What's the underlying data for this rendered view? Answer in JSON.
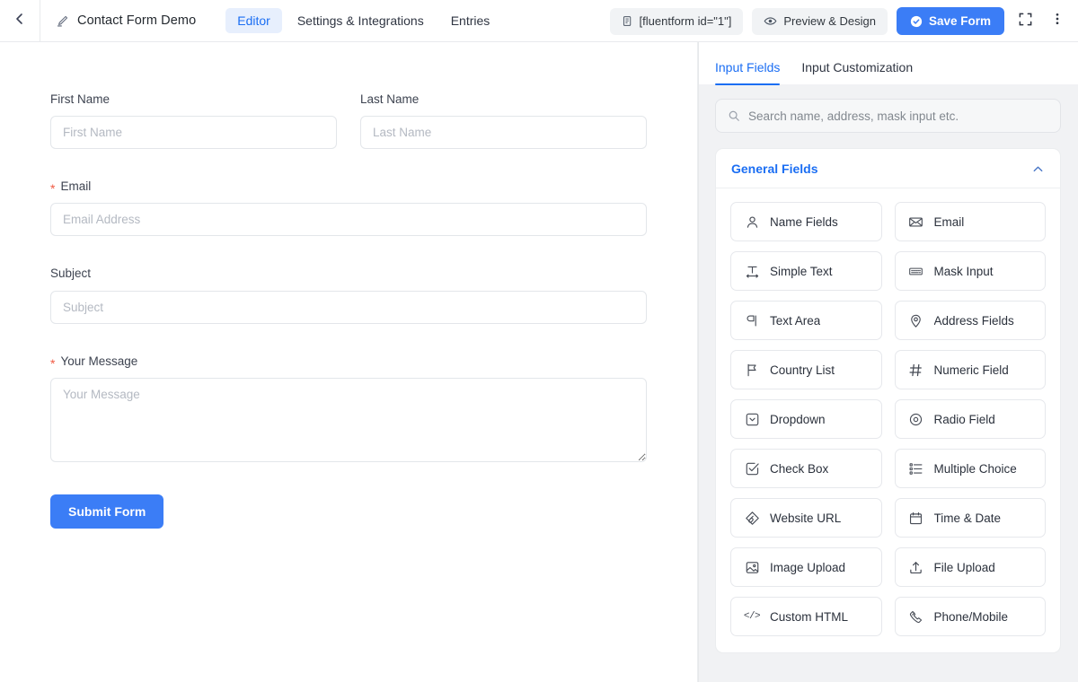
{
  "topbar": {
    "back_icon": "chevron-left-icon",
    "edit_icon": "pencil-icon",
    "form_title": "Contact Form Demo",
    "tabs": [
      {
        "label": "Editor",
        "active": true
      },
      {
        "label": "Settings & Integrations",
        "active": false
      },
      {
        "label": "Entries",
        "active": false
      }
    ],
    "shortcode_chip": {
      "icon": "copy-icon",
      "label": "[fluentform id=\"1\"]"
    },
    "preview_chip": {
      "icon": "eye-icon",
      "label": "Preview & Design"
    },
    "save_button": {
      "icon": "check-circle-icon",
      "label": "Save Form",
      "color": "#3b7df6"
    },
    "fullscreen_icon": "expand-icon",
    "more_icon": "kebab-menu-icon"
  },
  "canvas": {
    "fields": [
      {
        "label": "First Name",
        "required": false,
        "placeholder": "First Name",
        "type": "text",
        "half": true
      },
      {
        "label": "Last Name",
        "required": false,
        "placeholder": "Last Name",
        "type": "text",
        "half": true
      },
      {
        "label": "Email",
        "required": true,
        "placeholder": "Email Address",
        "type": "text",
        "half": false
      },
      {
        "label": "Subject",
        "required": false,
        "placeholder": "Subject",
        "type": "text",
        "half": false
      },
      {
        "label": "Your Message",
        "required": true,
        "placeholder": "Your Message",
        "type": "textarea",
        "half": false
      }
    ],
    "required_marker": "*",
    "submit_label": "Submit Form"
  },
  "sidebar": {
    "tabs": [
      {
        "label": "Input Fields",
        "active": true
      },
      {
        "label": "Input Customization",
        "active": false
      }
    ],
    "search": {
      "icon": "search-icon",
      "placeholder": "Search name, address, mask input etc.",
      "value": ""
    },
    "panel": {
      "title": "General Fields",
      "collapse_icon": "chevron-up-icon",
      "expanded": true,
      "items": [
        {
          "label": "Name Fields",
          "icon": "user-icon"
        },
        {
          "label": "Email",
          "icon": "envelope-icon"
        },
        {
          "label": "Simple Text",
          "icon": "text-width-icon"
        },
        {
          "label": "Mask Input",
          "icon": "mask-input-icon"
        },
        {
          "label": "Text Area",
          "icon": "paragraph-icon"
        },
        {
          "label": "Address Fields",
          "icon": "map-pin-icon"
        },
        {
          "label": "Country List",
          "icon": "flag-icon"
        },
        {
          "label": "Numeric Field",
          "icon": "hash-icon"
        },
        {
          "label": "Dropdown",
          "icon": "dropdown-icon"
        },
        {
          "label": "Radio Field",
          "icon": "radio-circle-icon"
        },
        {
          "label": "Check Box",
          "icon": "check-square-icon"
        },
        {
          "label": "Multiple Choice",
          "icon": "list-checklist-icon"
        },
        {
          "label": "Website URL",
          "icon": "link-diamond-icon"
        },
        {
          "label": "Time & Date",
          "icon": "calendar-icon"
        },
        {
          "label": "Image Upload",
          "icon": "image-icon"
        },
        {
          "label": "File Upload",
          "icon": "upload-icon"
        },
        {
          "label": "Custom HTML",
          "icon": "code-icon"
        },
        {
          "label": "Phone/Mobile",
          "icon": "phone-icon"
        }
      ]
    }
  },
  "colors": {
    "accent": "#3b7df6",
    "accent_soft": "#e7effd",
    "required": "#f05a43",
    "panel_bg": "#f1f2f4",
    "border": "#e3e6ea"
  }
}
